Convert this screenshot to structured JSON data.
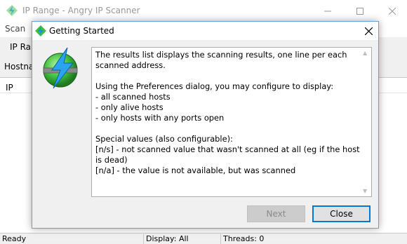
{
  "main_window": {
    "title": "IP Range - Angry IP Scanner",
    "menu": [
      "Scan"
    ],
    "toolbar_label": "IP Ra",
    "toolbar2_label": "Hostna",
    "column_header": "IP",
    "window_controls": [
      "minimize-icon",
      "maximize-icon",
      "close-icon"
    ]
  },
  "status_bar": {
    "state": "Ready",
    "display": "Display: All",
    "threads": "Threads: 0"
  },
  "dialog": {
    "title": "Getting Started",
    "icon": "angry-ip-scanner-logo",
    "body_text": "The results list displays the scanning results, one line per each scanned address.\n\nUsing the Preferences dialog, you may configure to display:\n- all scanned hosts\n- only alive hosts\n- only hosts with any ports open\n\nSpecial values (also configurable):\n[n/s] - not scanned value that wasn't scanned at all (eg if the host is dead)\n[n/a] - the value is not available, but was scanned",
    "buttons": {
      "next": "Next",
      "close": "Close"
    },
    "next_enabled": false
  },
  "colors": {
    "dialog_border": "#6aa0d8",
    "default_button_border": "#0078d7",
    "logo_green": "#3fbf3f",
    "logo_blue": "#1a8fe0"
  }
}
